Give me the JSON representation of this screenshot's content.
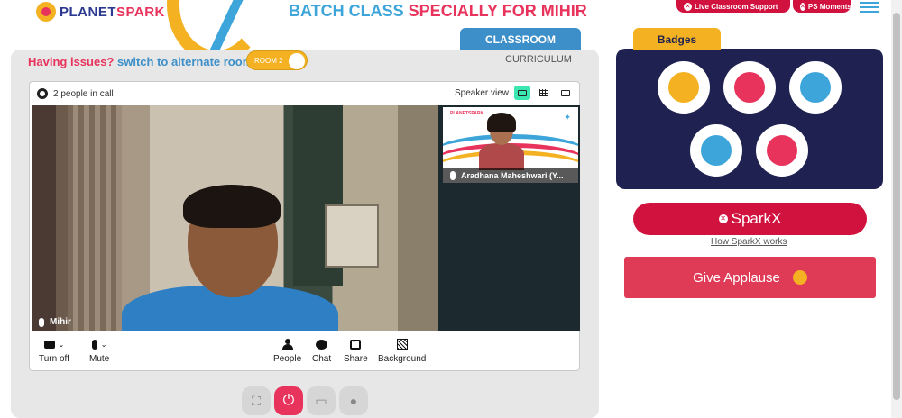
{
  "brand": {
    "planet": "PLANET",
    "spark": "SPARK"
  },
  "headline": {
    "part1": "BATCH CLASS ",
    "part2": "SPECIALLY FOR MIHIR"
  },
  "top_actions": {
    "live_support": "Live Classroom Support",
    "ps_moments": "PS Moments"
  },
  "tabs": {
    "classroom": "CLASSROOM",
    "curriculum": "CURRICULUM"
  },
  "room": {
    "issues_text": "Having issues?",
    "switch_link": "switch to alternate room",
    "toggle_label": "ROOM 2"
  },
  "call": {
    "people_count": "2 people in call",
    "view_label": "Speaker view",
    "main_participant": "Mihir",
    "side_participant": "Aradhana Maheshwari (Y...",
    "controls": {
      "turn_off": "Turn off",
      "mute": "Mute",
      "people": "People",
      "chat": "Chat",
      "share": "Share",
      "background": "Background"
    }
  },
  "badges": {
    "title": "Badges",
    "items": [
      "trophy-badge",
      "fist-badge",
      "hero-badge",
      "idea-badge",
      "brain-badge"
    ]
  },
  "sparkx": {
    "label": "SparkX",
    "how_link": "How SparkX works"
  },
  "applause": {
    "label": "Give Applause"
  },
  "colors": {
    "brand_pink": "#e8335c",
    "brand_blue": "#3da5d9",
    "brand_yellow": "#f4b223",
    "navy": "#1f2250",
    "red": "#d1123f"
  }
}
